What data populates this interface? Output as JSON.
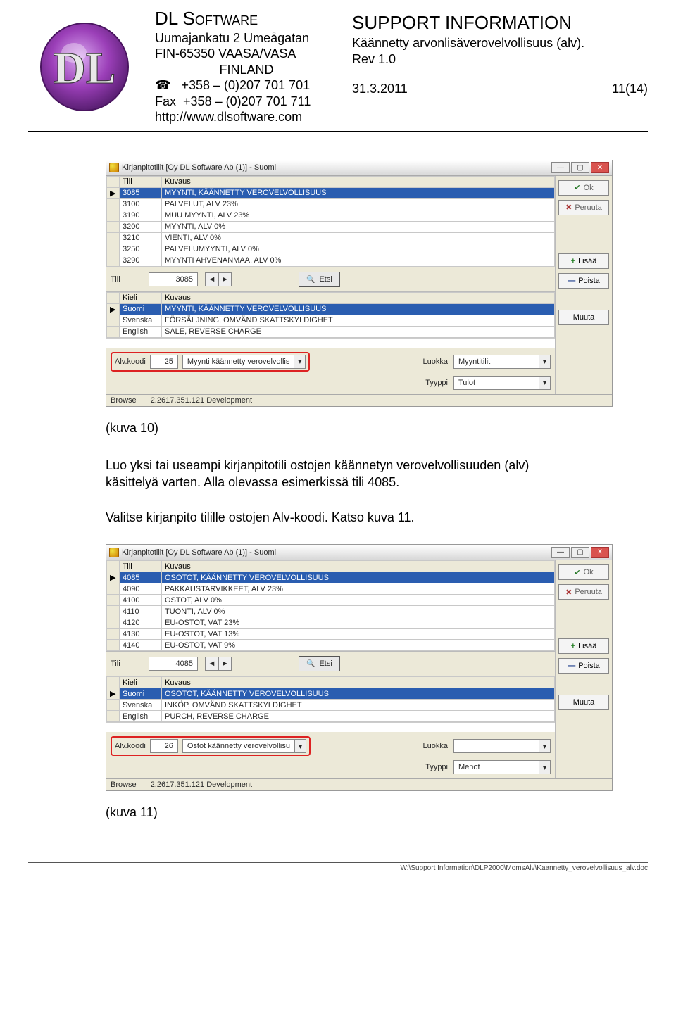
{
  "header": {
    "company_title": "DL Software",
    "addr1": "Uumajankatu 2 Umeågatan",
    "addr2": "FIN-65350 VAASA/VASA",
    "addr3": "FINLAND",
    "tel_icon": "☎",
    "tel": "+358 – (0)207 701 701",
    "fax_label": "Fax",
    "fax": "+358 – (0)207 701 711",
    "url": "http://www.dlsoftware.com",
    "support_title": "SUPPORT INFORMATION",
    "support_sub": "Käännetty arvonlisäverovelvollisuus  (alv).",
    "rev": "Rev 1.0",
    "date": "31.3.2011",
    "page": "11(14)"
  },
  "caption10": "(kuva 10)",
  "body1": "Luo yksi tai useampi kirjanpitotili ostojen käännetyn verovelvollisuuden (alv) käsittelyä varten. Alla olevassa esimerkissä tili 4085.",
  "body2": "Valitse kirjanpito tilille ostojen Alv-koodi. Katso kuva 11.",
  "caption11": "(kuva 11)",
  "footer_path": "W:\\Support Information\\DLP2000\\MomsAlv\\Kaannetty_verovelvollisuus_alv.doc",
  "win1": {
    "title": "Kirjanpitotilit  [Oy DL Software Ab (1)] - Suomi",
    "cols": {
      "c1": "Tili",
      "c2": "Kuvaus"
    },
    "rows": [
      {
        "tili": "3085",
        "kuvaus": "MYYNTI, KÄÄNNETTY VEROVELVOLLISUUS",
        "sel": true
      },
      {
        "tili": "3100",
        "kuvaus": "PALVELUT, ALV 23%"
      },
      {
        "tili": "3190",
        "kuvaus": "MUU MYYNTI, ALV 23%"
      },
      {
        "tili": "3200",
        "kuvaus": "MYYNTI, ALV 0%"
      },
      {
        "tili": "3210",
        "kuvaus": "VIENTI, ALV 0%"
      },
      {
        "tili": "3250",
        "kuvaus": "PALVELUMYYNTI, ALV 0%"
      },
      {
        "tili": "3290",
        "kuvaus": "MYYNTI AHVENANMAA, ALV 0%"
      }
    ],
    "tili_label": "Tili",
    "tili_val": "3085",
    "etsi": "Etsi",
    "lang_cols": {
      "c1": "Kieli",
      "c2": "Kuvaus"
    },
    "lang_rows": [
      {
        "k": "Suomi",
        "v": "MYYNTI, KÄÄNNETTY VEROVELVOLLISUUS",
        "sel": true
      },
      {
        "k": "Svenska",
        "v": "FÖRSÄLJNING, OMVÄND SKATTSKYLDIGHET"
      },
      {
        "k": "English",
        "v": "SALE, REVERSE CHARGE"
      }
    ],
    "alv_label": "Alv.koodi",
    "alv_val": "25",
    "alv_text": "Myynti käännetty verovelvollis",
    "luokka_label": "Luokka",
    "luokka_val": "Myyntitilit",
    "tyyppi_label": "Tyyppi",
    "tyyppi_val": "Tulot",
    "status_left": "Browse",
    "status_ver": "2.2617.351.121  Development",
    "btn_ok": "Ok",
    "btn_cancel": "Peruuta",
    "btn_add": "Lisää",
    "btn_del": "Poista",
    "btn_edit": "Muuta"
  },
  "win2": {
    "title": "Kirjanpitotilit  [Oy DL Software Ab (1)] - Suomi",
    "cols": {
      "c1": "Tili",
      "c2": "Kuvaus"
    },
    "rows": [
      {
        "tili": "4085",
        "kuvaus": "OSOTOT, KÄÄNNETTY VEROVELVOLLISUUS",
        "sel": true
      },
      {
        "tili": "4090",
        "kuvaus": "PAKKAUSTARVIKKEET, ALV 23%"
      },
      {
        "tili": "4100",
        "kuvaus": "OSTOT, ALV 0%"
      },
      {
        "tili": "4110",
        "kuvaus": "TUONTI, ALV 0%"
      },
      {
        "tili": "4120",
        "kuvaus": "EU-OSTOT, VAT 23%"
      },
      {
        "tili": "4130",
        "kuvaus": "EU-OSTOT, VAT 13%"
      },
      {
        "tili": "4140",
        "kuvaus": "EU-OSTOT, VAT 9%"
      }
    ],
    "tili_label": "Tili",
    "tili_val": "4085",
    "etsi": "Etsi",
    "lang_cols": {
      "c1": "Kieli",
      "c2": "Kuvaus"
    },
    "lang_rows": [
      {
        "k": "Suomi",
        "v": "OSOTOT, KÄÄNNETTY VEROVELVOLLISUUS",
        "sel": true
      },
      {
        "k": "Svenska",
        "v": "INKÖP, OMVÄND SKATTSKYLDIGHET"
      },
      {
        "k": "English",
        "v": "PURCH, REVERSE CHARGE"
      }
    ],
    "alv_label": "Alv.koodi",
    "alv_val": "26",
    "alv_text": "Ostot käännetty verovelvollisu",
    "luokka_label": "Luokka",
    "luokka_val": "",
    "tyyppi_label": "Tyyppi",
    "tyyppi_val": "Menot",
    "status_left": "Browse",
    "status_ver": "2.2617.351.121  Development",
    "btn_ok": "Ok",
    "btn_cancel": "Peruuta",
    "btn_add": "Lisää",
    "btn_del": "Poista",
    "btn_edit": "Muuta"
  }
}
